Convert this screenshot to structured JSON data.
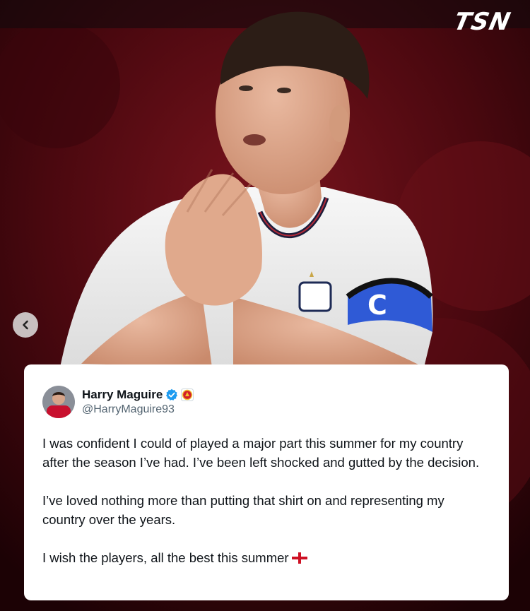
{
  "brand": {
    "logo_text": "TSN",
    "logo_color": "#ffffff"
  },
  "carousel": {
    "prev_icon": "chevron-left-icon"
  },
  "photo": {
    "subject": "footballer-applauding",
    "jersey_color": "#f3f3f3",
    "armband_letter": "C",
    "armband_color": "#2f5ad6",
    "background_color": "#5a0a12"
  },
  "tweet": {
    "display_name": "Harry Maguire",
    "handle": "@HarryMaguire93",
    "verified_icon": "verified-badge-icon",
    "affiliate_icon": "club-crest-icon",
    "paragraphs": [
      "I was confident I could of played a major part this summer for my country after the season I’ve had. I’ve been left shocked and gutted by the decision.",
      "I’ve loved nothing more than putting that shirt on and representing my country over the years."
    ],
    "closing_line": "I wish the players, all the best this summer",
    "closing_emoji": "england-flag-icon"
  }
}
